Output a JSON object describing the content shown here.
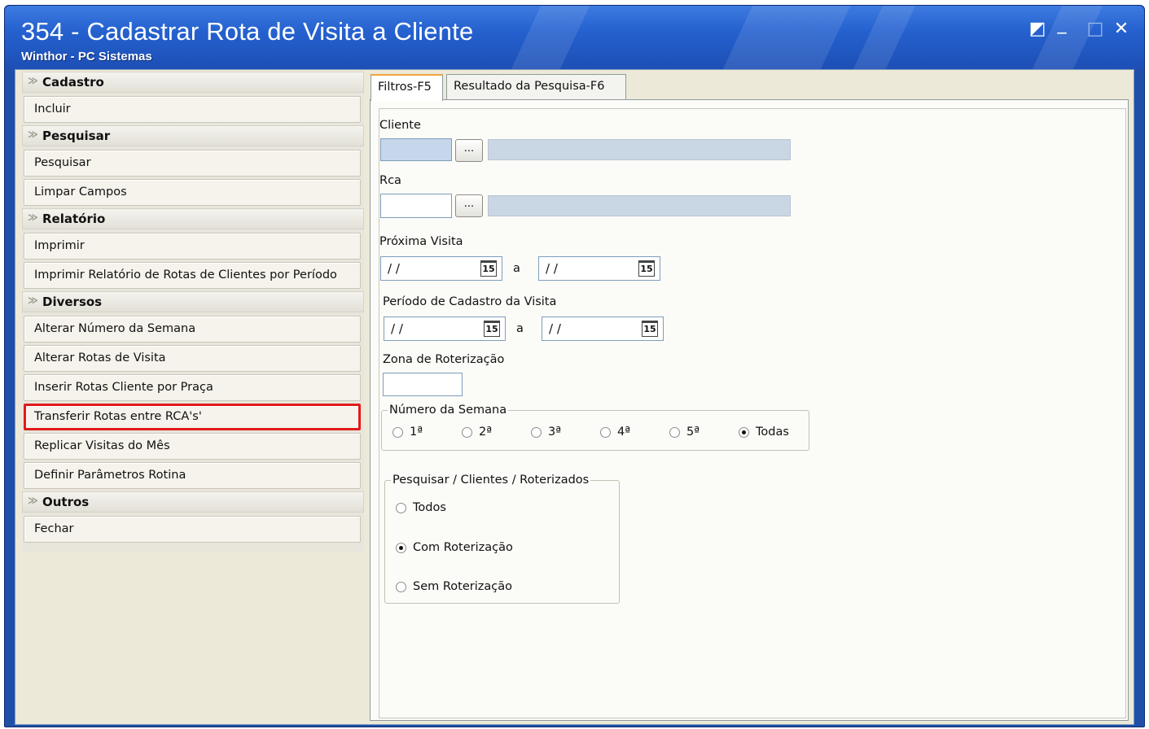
{
  "window": {
    "title": "354 - Cadastrar Rota de Visita a Cliente",
    "subtitle": "Winthor - PC Sistemas",
    "controls": {
      "restore_icon": "◩",
      "minimize_icon": "_",
      "maximize_icon": "□",
      "close_icon": "✕"
    }
  },
  "sidebar": {
    "groups": [
      {
        "header": "Cadastro",
        "items": [
          "Incluir"
        ]
      },
      {
        "header": "Pesquisar",
        "items": [
          "Pesquisar",
          "Limpar Campos"
        ]
      },
      {
        "header": "Relatório",
        "items": [
          "Imprimir",
          "Imprimir Relatório de Rotas de Clientes por Período"
        ]
      },
      {
        "header": "Diversos",
        "items": [
          "Alterar Número da Semana",
          "Alterar Rotas de Visita",
          "Inserir Rotas Cliente por Praça",
          "Transferir Rotas entre RCA's'",
          "Replicar Visitas do Mês",
          "Definir Parâmetros Rotina"
        ]
      },
      {
        "header": "Outros",
        "items": [
          "Fechar"
        ]
      }
    ],
    "chevron": "≫",
    "highlighted_item": "Transferir Rotas entre RCA's'",
    "highlight_color": "#e01b1b"
  },
  "tabs": [
    {
      "label": "Filtros-F5",
      "active": true
    },
    {
      "label": "Resultado da Pesquisa-F6",
      "active": false
    }
  ],
  "form": {
    "cliente": {
      "label": "Cliente",
      "code_value": "",
      "name_value": "",
      "lookup_label": "..."
    },
    "rca": {
      "label": "Rca",
      "code_value": "",
      "name_value": "",
      "lookup_label": "..."
    },
    "proxima_visita": {
      "label": "Próxima Visita",
      "from": "/ /",
      "to": "/ /",
      "sep": "a",
      "calendar_glyph": "15"
    },
    "periodo_cadastro": {
      "label": "Período de Cadastro da Visita",
      "from": "/ /",
      "to": "/ /",
      "sep": "a",
      "calendar_glyph": "15"
    },
    "zona": {
      "label": "Zona de Roterização",
      "value": ""
    },
    "numero_semana": {
      "legend": "Número da Semana",
      "options": [
        "1ª",
        "2ª",
        "3ª",
        "4ª",
        "5ª",
        "Todas"
      ],
      "selected": "Todas"
    },
    "pesquisar_clientes": {
      "legend": "Pesquisar / Clientes / Roterizados",
      "options": [
        "Todos",
        "Com Roterização",
        "Sem Roterização"
      ],
      "selected": "Com Roterização"
    }
  }
}
